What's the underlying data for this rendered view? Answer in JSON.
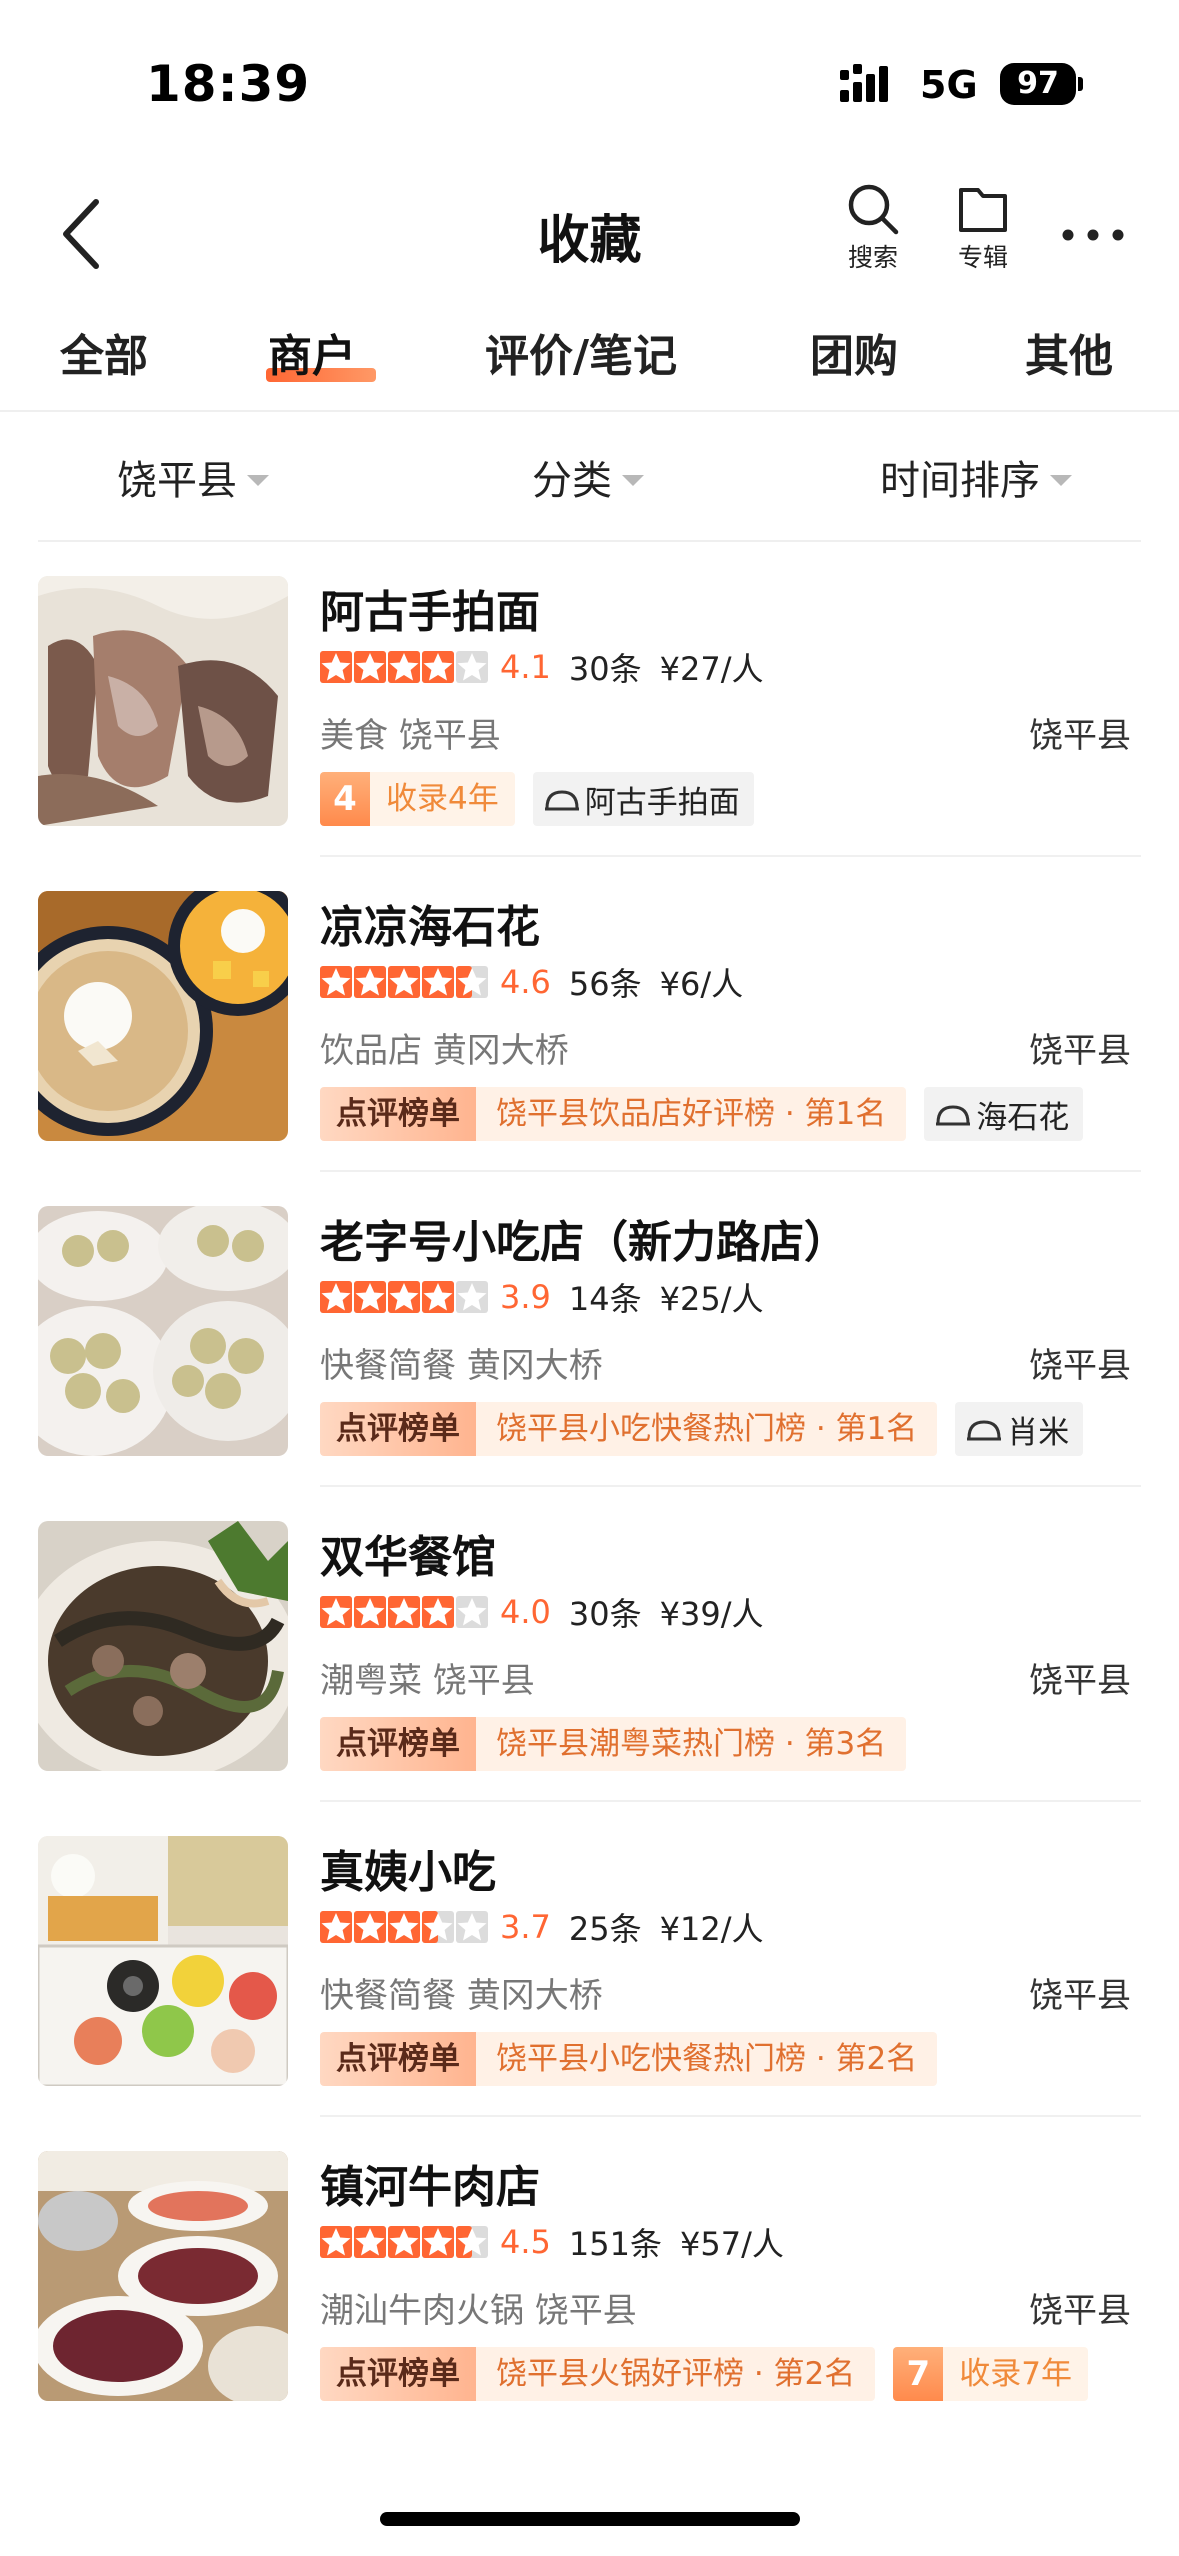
{
  "status": {
    "time": "18:39",
    "network": "5G",
    "battery": "97"
  },
  "nav": {
    "title": "收藏",
    "search_label": "搜索",
    "album_label": "专辑"
  },
  "tabs": [
    {
      "label": "全部"
    },
    {
      "label": "商户",
      "active": true
    },
    {
      "label": "评价/笔记"
    },
    {
      "label": "团购"
    },
    {
      "label": "其他"
    }
  ],
  "filters": {
    "region": "饶平县",
    "category": "分类",
    "sort": "时间排序"
  },
  "colors": {
    "accent": "#ff6633",
    "star": "#ff6633",
    "star_empty": "#dcdcdc"
  },
  "items": [
    {
      "name": "阿古手拍面",
      "rating": 4.1,
      "score": "4.1",
      "reviews": "30条",
      "price": "¥27/人",
      "category": "美食 饶平县",
      "region": "饶平县",
      "years": {
        "num": "4",
        "text": "收录4年"
      },
      "dish": "阿古手拍面"
    },
    {
      "name": "凉凉海石花",
      "rating": 4.6,
      "score": "4.6",
      "reviews": "56条",
      "price": "¥6/人",
      "category": "饮品店 黄冈大桥",
      "region": "饶平县",
      "rank": {
        "logo": "点评榜单",
        "text": "饶平县饮品店好评榜 · 第1名"
      },
      "dish": "海石花"
    },
    {
      "name": "老字号小吃店（新力路店）",
      "rating": 3.9,
      "score": "3.9",
      "reviews": "14条",
      "price": "¥25/人",
      "category": "快餐简餐 黄冈大桥",
      "region": "饶平县",
      "rank": {
        "logo": "点评榜单",
        "text": "饶平县小吃快餐热门榜 · 第1名"
      },
      "dish": "肖米"
    },
    {
      "name": "双华餐馆",
      "rating": 4.0,
      "score": "4.0",
      "reviews": "30条",
      "price": "¥39/人",
      "category": "潮粤菜 饶平县",
      "region": "饶平县",
      "rank": {
        "logo": "点评榜单",
        "text": "饶平县潮粤菜热门榜 · 第3名"
      }
    },
    {
      "name": "真姨小吃",
      "rating": 3.7,
      "score": "3.7",
      "reviews": "25条",
      "price": "¥12/人",
      "category": "快餐简餐 黄冈大桥",
      "region": "饶平县",
      "rank": {
        "logo": "点评榜单",
        "text": "饶平县小吃快餐热门榜 · 第2名"
      }
    },
    {
      "name": "镇河牛肉店",
      "rating": 4.5,
      "score": "4.5",
      "reviews": "151条",
      "price": "¥57/人",
      "category": "潮汕牛肉火锅 饶平县",
      "region": "饶平县",
      "rank": {
        "logo": "点评榜单",
        "text": "饶平县火锅好评榜 · 第2名"
      },
      "years": {
        "num": "7",
        "text": "收录7年"
      }
    }
  ]
}
